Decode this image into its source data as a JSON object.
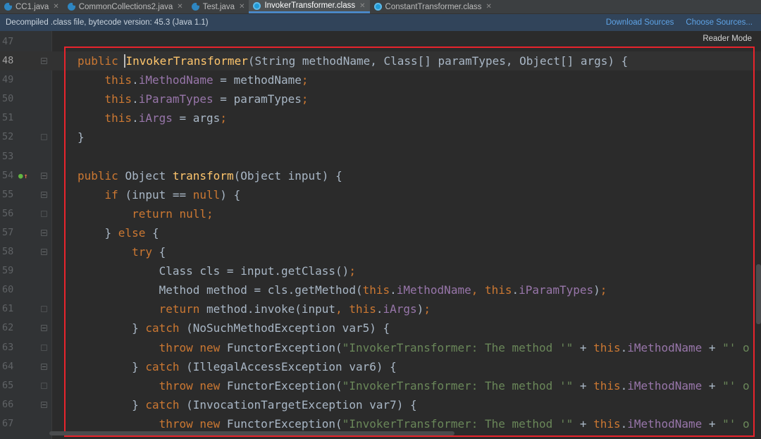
{
  "tabs": [
    {
      "label": "CC1.java",
      "type": "java",
      "active": false
    },
    {
      "label": "CommonCollections2.java",
      "type": "java",
      "active": false
    },
    {
      "label": "Test.java",
      "type": "java",
      "active": false
    },
    {
      "label": "InvokerTransformer.class",
      "type": "class",
      "active": true
    },
    {
      "label": "ConstantTransformer.class",
      "type": "class",
      "active": false
    }
  ],
  "banner": {
    "message": "Decompiled .class file, bytecode version: 45.3 (Java 1.1)",
    "download_sources": "Download Sources",
    "choose_sources": "Choose Sources..."
  },
  "editor": {
    "reader_mode": "Reader Mode",
    "current_line": "48",
    "line_numbers": [
      "47",
      "48",
      "49",
      "50",
      "51",
      "52",
      "53",
      "54",
      "55",
      "56",
      "57",
      "58",
      "59",
      "60",
      "61",
      "62",
      "63",
      "64",
      "65",
      "66",
      "67"
    ]
  },
  "code_lines": [
    [],
    [
      [
        "kw",
        "public "
      ],
      [
        "caret",
        ""
      ],
      [
        "fn",
        "InvokerTransformer"
      ],
      [
        "p",
        "(String methodName, Class[] paramTypes, Object[] args) {"
      ]
    ],
    [
      [
        "p",
        "    "
      ],
      [
        "kw",
        "this"
      ],
      [
        "p",
        "."
      ],
      [
        "fld",
        "iMethodName"
      ],
      [
        "p",
        " = methodName"
      ],
      [
        "kw",
        ";"
      ]
    ],
    [
      [
        "p",
        "    "
      ],
      [
        "kw",
        "this"
      ],
      [
        "p",
        "."
      ],
      [
        "fld",
        "iParamTypes"
      ],
      [
        "p",
        " = paramTypes"
      ],
      [
        "kw",
        ";"
      ]
    ],
    [
      [
        "p",
        "    "
      ],
      [
        "kw",
        "this"
      ],
      [
        "p",
        "."
      ],
      [
        "fld",
        "iArgs"
      ],
      [
        "p",
        " = args"
      ],
      [
        "kw",
        ";"
      ]
    ],
    [
      [
        "p",
        "}"
      ]
    ],
    [],
    [
      [
        "kw",
        "public "
      ],
      [
        "p",
        "Object "
      ],
      [
        "fn",
        "transform"
      ],
      [
        "p",
        "(Object input) {"
      ]
    ],
    [
      [
        "p",
        "    "
      ],
      [
        "kw",
        "if "
      ],
      [
        "p",
        "(input == "
      ],
      [
        "kw",
        "null"
      ],
      [
        "p",
        ") {"
      ]
    ],
    [
      [
        "p",
        "        "
      ],
      [
        "kw",
        "return null;"
      ]
    ],
    [
      [
        "p",
        "    } "
      ],
      [
        "kw",
        "else "
      ],
      [
        "p",
        "{"
      ]
    ],
    [
      [
        "p",
        "        "
      ],
      [
        "kw",
        "try "
      ],
      [
        "p",
        "{"
      ]
    ],
    [
      [
        "p",
        "            Class cls = input.getClass()"
      ],
      [
        "kw",
        ";"
      ]
    ],
    [
      [
        "p",
        "            Method method = cls.getMethod("
      ],
      [
        "kw",
        "this"
      ],
      [
        "p",
        "."
      ],
      [
        "fld",
        "iMethodName"
      ],
      [
        "kw",
        ", this"
      ],
      [
        "p",
        "."
      ],
      [
        "fld",
        "iParamTypes"
      ],
      [
        "p",
        ")"
      ],
      [
        "kw",
        ";"
      ]
    ],
    [
      [
        "p",
        "            "
      ],
      [
        "kw",
        "return "
      ],
      [
        "p",
        "method.invoke(input"
      ],
      [
        "kw",
        ", this"
      ],
      [
        "p",
        "."
      ],
      [
        "fld",
        "iArgs"
      ],
      [
        "p",
        ")"
      ],
      [
        "kw",
        ";"
      ]
    ],
    [
      [
        "p",
        "        } "
      ],
      [
        "kw",
        "catch "
      ],
      [
        "p",
        "(NoSuchMethodException var5) {"
      ]
    ],
    [
      [
        "p",
        "            "
      ],
      [
        "kw",
        "throw new "
      ],
      [
        "p",
        "FunctorException("
      ],
      [
        "str",
        "\"InvokerTransformer: The method '\""
      ],
      [
        "p",
        " + "
      ],
      [
        "kw",
        "this"
      ],
      [
        "p",
        "."
      ],
      [
        "fld",
        "iMethodName"
      ],
      [
        "p",
        " + "
      ],
      [
        "str",
        "\"' o"
      ]
    ],
    [
      [
        "p",
        "        } "
      ],
      [
        "kw",
        "catch "
      ],
      [
        "p",
        "(IllegalAccessException var6) {"
      ]
    ],
    [
      [
        "p",
        "            "
      ],
      [
        "kw",
        "throw new "
      ],
      [
        "p",
        "FunctorException("
      ],
      [
        "str",
        "\"InvokerTransformer: The method '\""
      ],
      [
        "p",
        " + "
      ],
      [
        "kw",
        "this"
      ],
      [
        "p",
        "."
      ],
      [
        "fld",
        "iMethodName"
      ],
      [
        "p",
        " + "
      ],
      [
        "str",
        "\"' o"
      ]
    ],
    [
      [
        "p",
        "        } "
      ],
      [
        "kw",
        "catch "
      ],
      [
        "p",
        "(InvocationTargetException var7) {"
      ]
    ],
    [
      [
        "p",
        "            "
      ],
      [
        "kw",
        "throw new "
      ],
      [
        "p",
        "FunctorException("
      ],
      [
        "str",
        "\"InvokerTransformer: The method '\""
      ],
      [
        "p",
        " + "
      ],
      [
        "kw",
        "this"
      ],
      [
        "p",
        "."
      ],
      [
        "fld",
        "iMethodName"
      ],
      [
        "p",
        " + "
      ],
      [
        "str",
        "\"' o"
      ]
    ]
  ],
  "gutter": {
    "override_icon": "override-method-icon",
    "fold_icon": "fold-marker-icon"
  },
  "colors": {
    "highlight_box": "#e8242c",
    "keyword": "#cc7832",
    "method": "#ffc66d",
    "field": "#9876aa",
    "string": "#6a8759"
  }
}
